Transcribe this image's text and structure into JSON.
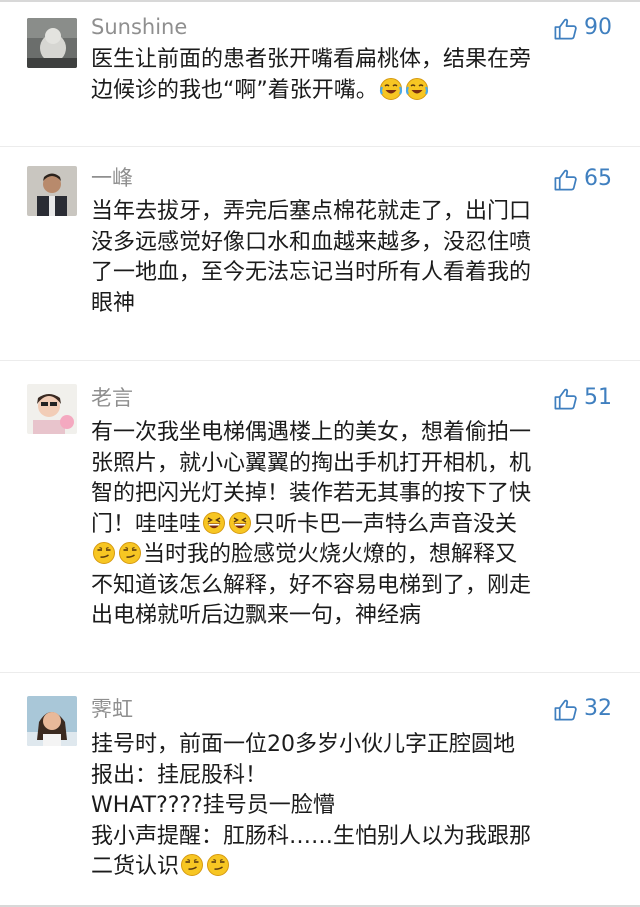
{
  "comments": [
    {
      "username": "Sunshine",
      "likes": "90",
      "lines": [
        "医生让前面的患者张开嘴看扁桃体，结果在旁",
        "边候诊的我也“啊”着张开嘴。"
      ]
    },
    {
      "username": "一峰",
      "likes": "65",
      "lines": [
        "当年去拔牙，弄完后塞点棉花就走了，出门口",
        "没多远感觉好像口水和血越来越多，没忍住喷",
        "了一地血，至今无法忘记当时所有人看着我的",
        "眼神"
      ]
    },
    {
      "username": "老言",
      "likes": "51",
      "lines": [
        "有一次我坐电梯偶遇楼上的美女，想着偷拍一",
        "张照片，就小心翼翼的掏出手机打开相机，机",
        "智的把闪光灯关掉！装作若无其事的按下了快",
        "门！哇哇哇",
        "只听卡巴一声特么声音没关",
        "当时我的脸感觉火烧火燎的，想解释又",
        "不知道该怎么解释，好不容易电梯到了，刚走",
        "出电梯就听后边飘来一句，神经病"
      ]
    },
    {
      "username": "霁虹",
      "likes": "32",
      "lines": [
        "挂号时，前面一位20多岁小伙儿字正腔圆地",
        "报出：挂屁股科！",
        "WHAT????挂号员一脸懵",
        "我小声提醒：肛肠科……生怕别人以为我跟那",
        "二货认识"
      ]
    }
  ],
  "icons": {
    "like": "thumbs-up-icon",
    "laugh_cry": "face-with-tears-of-joy-icon",
    "grin": "grinning-squinting-face-icon",
    "smirk": "smirking-face-icon"
  },
  "colors": {
    "username": "#8f8f8f",
    "likes": "#3f7fbf",
    "text": "#1b1b1b"
  }
}
